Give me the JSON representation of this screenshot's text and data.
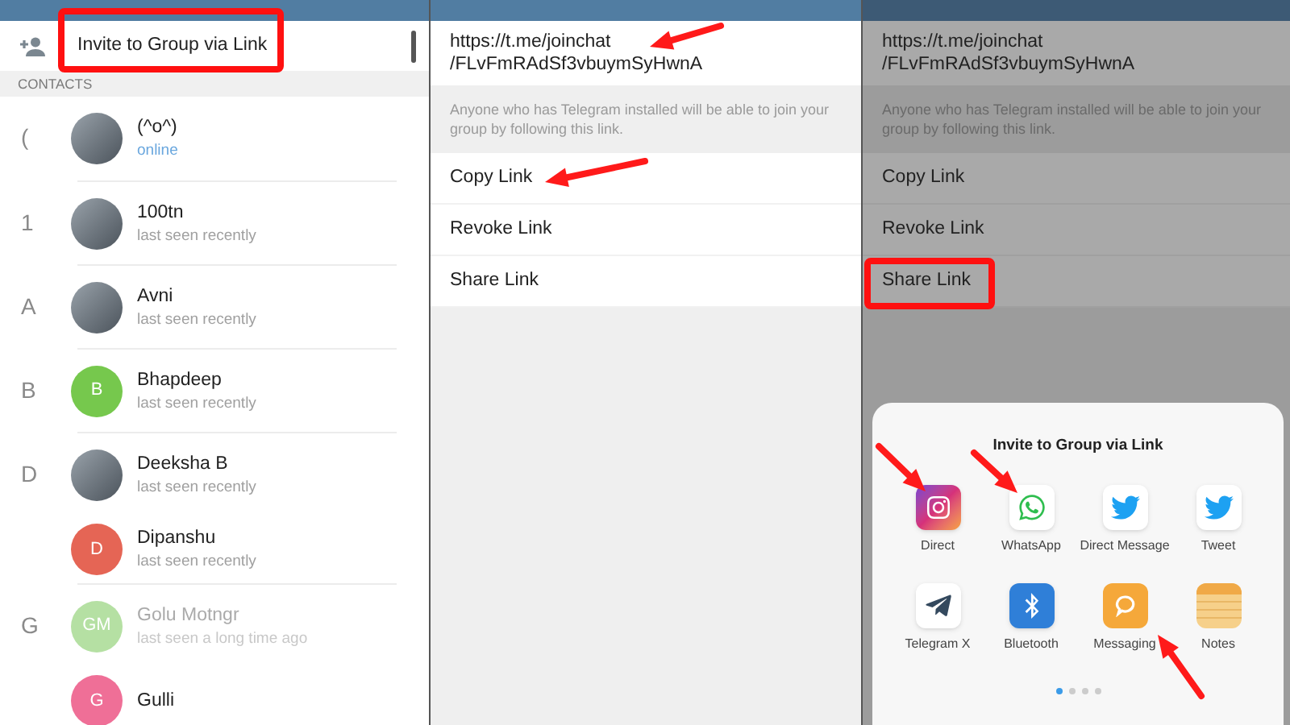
{
  "contacts_screen": {
    "invite_row": {
      "label": "Invite to Group via Link"
    },
    "section_header": "CONTACTS",
    "contacts": [
      {
        "section": "(",
        "name": "(^o^)",
        "status": "online",
        "online": true,
        "inactive": false,
        "avatar": {
          "kind": "photo"
        }
      },
      {
        "section": "1",
        "name": "100tn",
        "status": "last seen recently",
        "online": false,
        "inactive": false,
        "avatar": {
          "kind": "photo"
        }
      },
      {
        "section": "A",
        "name": "Avni",
        "status": "last seen recently",
        "online": false,
        "inactive": false,
        "avatar": {
          "kind": "photo"
        }
      },
      {
        "section": "B",
        "name": "Bhapdeep",
        "status": "last seen recently",
        "online": false,
        "inactive": false,
        "avatar": {
          "kind": "initials",
          "initials": "B",
          "color": "#76c84d"
        }
      },
      {
        "section": "D",
        "name": "Deeksha B",
        "status": "last seen recently",
        "online": false,
        "inactive": false,
        "avatar": {
          "kind": "photo"
        }
      },
      {
        "name": "Dipanshu",
        "status": "last seen recently",
        "online": false,
        "inactive": false,
        "avatar": {
          "kind": "initials",
          "initials": "D",
          "color": "#e56555"
        }
      },
      {
        "section": "G",
        "name": "Golu Motngr",
        "status": "last seen a long time ago",
        "online": false,
        "inactive": true,
        "avatar": {
          "kind": "initials",
          "initials": "GM",
          "color": "#b5e0a3"
        }
      },
      {
        "name": "Gulli",
        "online": false,
        "inactive": false,
        "avatar": {
          "kind": "initials",
          "initials": "G",
          "color": "#ef6f97"
        }
      }
    ]
  },
  "link_screens": [
    {
      "dimmed": false,
      "link": [
        "https://t.me/joinchat",
        "/FLvFmRAdSf3vbuymSyHwnA"
      ],
      "hint": "Anyone who has Telegram installed will be able to join your group by following this link.",
      "actions": [
        "Copy Link",
        "Revoke Link",
        "Share Link"
      ]
    },
    {
      "dimmed": true,
      "link": [
        "https://t.me/joinchat",
        "/FLvFmRAdSf3vbuymSyHwnA"
      ],
      "hint": "Anyone who has Telegram installed will be able to join your group by following this link.",
      "actions": [
        "Copy Link",
        "Revoke Link",
        "Share Link"
      ],
      "share_sheet": {
        "title": "Invite to Group via Link",
        "apps": [
          {
            "label": "Direct",
            "kind": "instagram"
          },
          {
            "label": "WhatsApp",
            "kind": "whatsapp"
          },
          {
            "label": "Direct Message",
            "kind": "twitter"
          },
          {
            "label": "Tweet",
            "kind": "twitter"
          },
          {
            "label": "Telegram X",
            "kind": "telegram"
          },
          {
            "label": "Bluetooth",
            "kind": "bluetooth"
          },
          {
            "label": "Messaging",
            "kind": "message"
          },
          {
            "label": "Notes",
            "kind": "notes"
          }
        ],
        "pages": [
          {
            "selected": true
          },
          {
            "selected": false
          },
          {
            "selected": false
          },
          {
            "selected": false
          }
        ]
      }
    }
  ]
}
